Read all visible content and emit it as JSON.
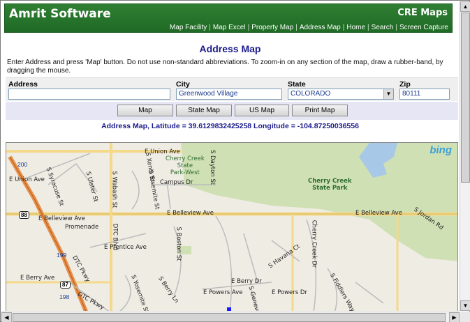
{
  "header": {
    "brand": "Amrit Software",
    "product": "CRE Maps",
    "nav": [
      "Map Facility",
      "Map Excel",
      "Property Map",
      "Address Map",
      "Home",
      "Search",
      "Screen Capture"
    ],
    "separator": "|"
  },
  "page": {
    "title": "Address Map",
    "instructions": "Enter Address and press 'Map' button. Do not use non-standard abbreviations. To zoom-in on any section of the map, draw a rubber-band, by dragging the mouse."
  },
  "form": {
    "address_label": "Address",
    "address_value": "",
    "city_label": "City",
    "city_value": "Greenwood Village",
    "state_label": "State",
    "state_value": "COLORADO",
    "zip_label": "Zip",
    "zip_value": "80111"
  },
  "buttons": {
    "map": "Map",
    "state_map": "State Map",
    "us_map": "US Map",
    "print_map": "Print Map"
  },
  "result": {
    "latlong": "Address Map, Latitude = 39.6129832425258 Longitude = -104.87250036556"
  },
  "map": {
    "brand": "bing",
    "labels": {
      "union_ave_top": "E Union Ave",
      "union_ave_left": "E Union Ave",
      "cherry_creek_west": "Cherry Creek\nState\nPark-West",
      "cherry_creek_park": "Cherry Creek\nState Park",
      "campus_dr": "Campus Dr",
      "belleview_left": "E Belleview Ave",
      "belleview_mid": "E Belleview Ave",
      "belleview_right": "E Belleview Ave",
      "promenade": "Promenade",
      "prentice": "E Prentice Ave",
      "berry_ave": "E Berry Ave",
      "berry_dr": "E Berry Dr",
      "powers_ave": "E Powers Ave",
      "powers_dr": "E Powers Dr",
      "jordan_rd": "S Jordan Rd",
      "syracuse": "S Syracuse St",
      "ulster": "S Ulster St",
      "wabash": "S Wabash St",
      "dtc_blvd": "DTC Blvd",
      "yosemite": "S Yosemite St",
      "xenia": "S Xenia St",
      "dayton": "S Dayton St",
      "boston": "S Boston St",
      "dtc_pkwy": "DTC Pkwy",
      "yosemite_low": "S Yosemite St",
      "berry_ln": "S Berry Ln",
      "fiddlers": "S Fiddlers Way",
      "havana": "S Havana Ct",
      "cherry_creek_dr": "Cherry Creek Dr",
      "geneva": "S Geneva St",
      "dtc_pkwy2": "DTC Pkwy"
    },
    "shields": {
      "i25": "88",
      "r87": "87"
    },
    "routes": {
      "r200": "200",
      "r199": "199",
      "r198": "198"
    }
  },
  "colors": {
    "header_green": "#2f7f33",
    "title_blue": "#1a1a8c",
    "park_green": "#cfe0b4",
    "highway_orange": "#e8904a",
    "road_yellow": "#f4d98a"
  }
}
